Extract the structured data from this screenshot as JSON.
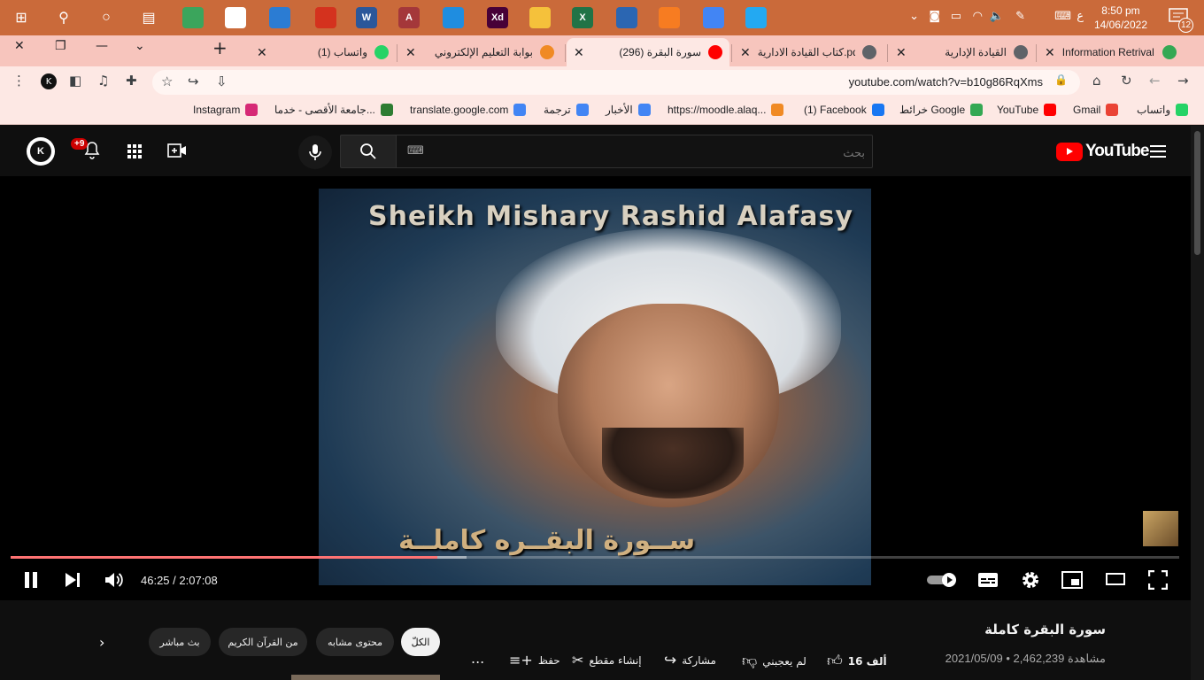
{
  "taskbar": {
    "apps": [
      {
        "name": "windows-start-icon",
        "label": "",
        "color": "#ffffff"
      },
      {
        "name": "search-icon",
        "label": "",
        "color": "#ffffff"
      },
      {
        "name": "cortana-icon",
        "label": "",
        "color": "#ffffff"
      },
      {
        "name": "task-view-icon",
        "label": "",
        "color": "#ffffff"
      },
      {
        "name": "app-green-icon",
        "label": "",
        "color": "#3ba55c"
      },
      {
        "name": "store-icon",
        "label": "",
        "color": "#ffffff"
      },
      {
        "name": "mail-icon",
        "label": "",
        "color": "#2b7cd3"
      },
      {
        "name": "acrobat-icon",
        "label": "",
        "color": "#d4321e"
      },
      {
        "name": "word-icon",
        "label": "W",
        "color": "#2b579a"
      },
      {
        "name": "access-icon",
        "label": "A",
        "color": "#a4373a"
      },
      {
        "name": "whatsapp-desktop-icon",
        "label": "",
        "color": "#1f8de0"
      },
      {
        "name": "adobe-xd-icon",
        "label": "Xd",
        "color": "#470137"
      },
      {
        "name": "file-explorer-icon",
        "label": "",
        "color": "#f5c13b"
      },
      {
        "name": "excel-icon",
        "label": "X",
        "color": "#217346"
      },
      {
        "name": "virtualbox-icon",
        "label": "",
        "color": "#2b66b2"
      },
      {
        "name": "xampp-icon",
        "label": "",
        "color": "#f77c21"
      },
      {
        "name": "chrome-icon",
        "label": "",
        "color": "#4285f4"
      },
      {
        "name": "vscode-icon",
        "label": "",
        "color": "#23a9f2"
      }
    ],
    "clock_time": "8:50 pm",
    "clock_date": "14/06/2022",
    "language": "ع",
    "notification_count": "12"
  },
  "tabs": [
    {
      "title": "Information Retrival -",
      "favicon_color": "#34a853",
      "active": false
    },
    {
      "title": "القيادة الإدارية",
      "favicon_color": "#5f6368",
      "active": false
    },
    {
      "title": "كتاب القيادة الادارية.pdf",
      "favicon_color": "#5f6368",
      "active": false
    },
    {
      "title": "(296) سورة البقرة",
      "favicon_color": "#ff0000",
      "active": true
    },
    {
      "title": "بوابة التعليم الإلكتروني",
      "favicon_color": "#f08a24",
      "active": false
    },
    {
      "title": "(1) واتساب",
      "favicon_color": "#25d366",
      "active": false
    }
  ],
  "address": {
    "url": "youtube.com/watch?v=b10g86RqXms"
  },
  "bookmarks": [
    {
      "label": "واتساب",
      "color": "#25d366"
    },
    {
      "label": "Gmail",
      "color": "#ea4335"
    },
    {
      "label": "YouTube",
      "color": "#ff0000"
    },
    {
      "label": "خرائط Google",
      "color": "#34a853"
    },
    {
      "label": "(1) Facebook",
      "color": "#1877f2"
    },
    {
      "label": "https://moodle.alaq...",
      "color": "#f08a24"
    },
    {
      "label": "الأخبار",
      "color": "#4285f4"
    },
    {
      "label": "ترجمة",
      "color": "#4285f4"
    },
    {
      "label": "translate.google.com",
      "color": "#4285f4"
    },
    {
      "label": "جامعة الأقصى - خدما...",
      "color": "#2e7d32"
    },
    {
      "label": "Instagram",
      "color": "#d62976"
    }
  ],
  "youtube": {
    "logo_text": "YouTube",
    "search_placeholder": "بحث",
    "notifications_badge": "+9",
    "video": {
      "overlay_title": "Sheikh Mishary Rashid Alafasy",
      "overlay_subtitle": "ســورة البقــره كاملــة",
      "current_time": "46:25",
      "duration": "2:07:08",
      "progress": 0.365,
      "buffered": 0.39
    },
    "title": "سورة البقرة كاملة",
    "views": "2,462,239 مشاهدة",
    "date": "2021/05/09",
    "likes": "16 ألف",
    "dislike_label": "لم يعجبني",
    "share_label": "مشاركة",
    "clip_label": "إنشاء مقطع",
    "save_label": "حفظ",
    "more_label": "...",
    "chips": [
      {
        "label": "الكلّ",
        "selected": true
      },
      {
        "label": "محتوى مشابه",
        "selected": false
      },
      {
        "label": "من القرآن الكريم",
        "selected": false
      },
      {
        "label": "بث مباشر",
        "selected": false
      }
    ]
  }
}
